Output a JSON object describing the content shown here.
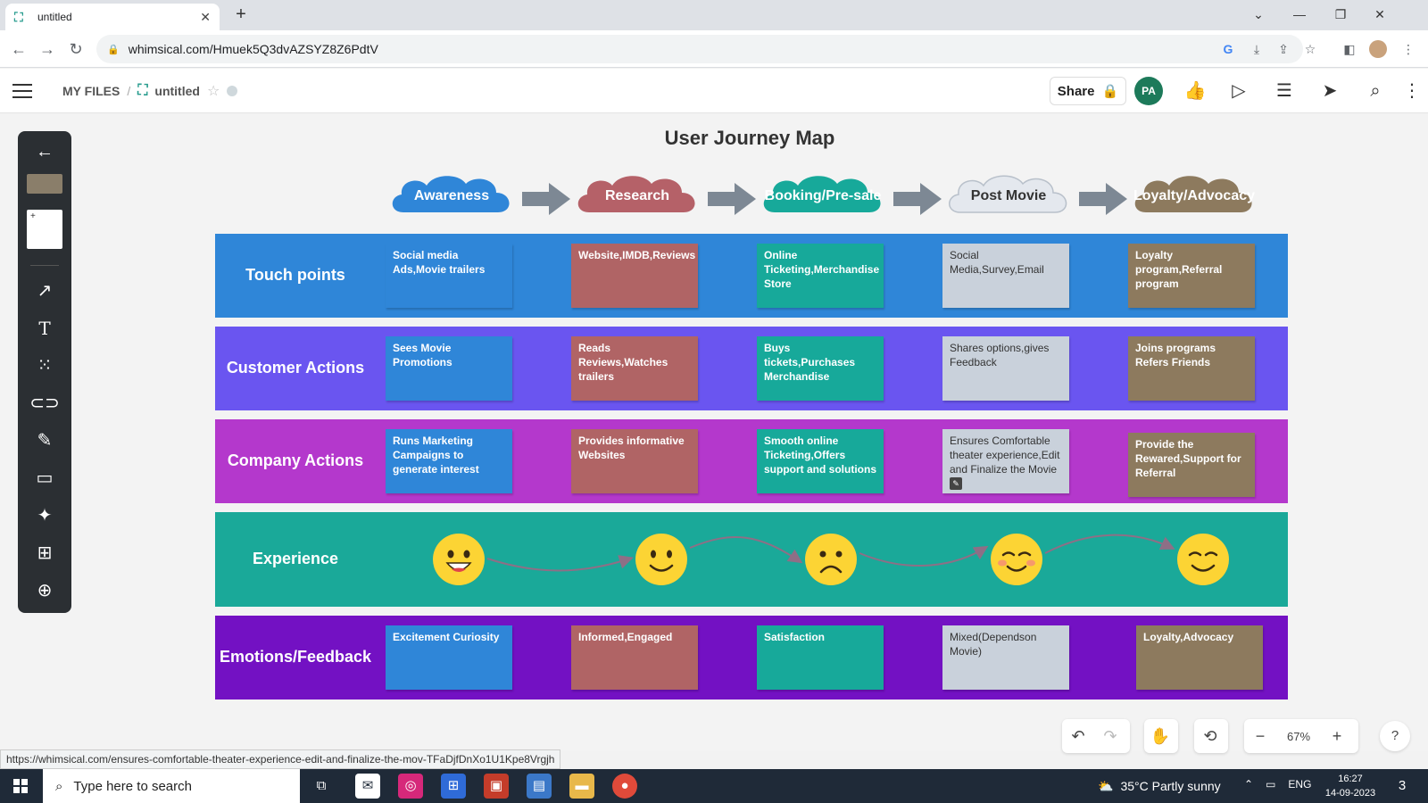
{
  "browser": {
    "tab_title": "untitled",
    "url": "whimsical.com/Hmuek5Q3dvAZSYZ8Z6PdtV",
    "status_url": "https://whimsical.com/ensures-comfortable-theater-experience-edit-and-finalize-the-mov-TFaDjfDnXo1U1Kpe8Vrgjh"
  },
  "header": {
    "my_files": "MY FILES",
    "separator": "/",
    "doc_title": "untitled",
    "share_label": "Share",
    "avatar_initials": "PA"
  },
  "board": {
    "title": "User Journey Map",
    "stages": [
      {
        "label": "Awareness",
        "color": "#2f86d8"
      },
      {
        "label": "Research",
        "color": "#b56168"
      },
      {
        "label": "Booking/Pre-sale",
        "color": "#17a99a"
      },
      {
        "label": "Post Movie",
        "color": "#e4e8ee"
      },
      {
        "label": "Loyalty/Advocacy",
        "color": "#8d7a5e"
      }
    ],
    "rows": [
      {
        "label": "Touch points",
        "color": "#2f86d8",
        "notes": [
          "Social media Ads,Movie trailers",
          "Website,IMDB,Reviews",
          "Online Ticketing,Merchandise Store",
          "Social Media,Survey,Email",
          "Loyalty program,Referral program"
        ]
      },
      {
        "label": "Customer Actions",
        "color": "#6a55f0",
        "notes": [
          "Sees Movie Promotions",
          "Reads Reviews,Watches trailers",
          "Buys tickets,Purchases Merchandise",
          "Shares options,gives Feedback",
          "Joins programs Refers Friends"
        ]
      },
      {
        "label": "Company Actions",
        "color": "#b438cc",
        "notes": [
          "Runs Marketing Campaigns to generate interest",
          "Provides informative Websites",
          "Smooth online Ticketing,Offers support and solutions",
          "Ensures Comfortable theater experience,Edit and Finalize the Movie",
          "Provide the Rewared,Support for Referral"
        ]
      },
      {
        "label": "Experience",
        "color": "#1aa999"
      },
      {
        "label": "Emotions/Feedback",
        "color": "#7311c3",
        "notes": [
          "Excitement Curiosity",
          "Informed,Engaged",
          "Satisfaction",
          "Mixed(Dependson Movie)",
          "Loyalty,Advocacy"
        ]
      }
    ],
    "note_colors": [
      "#2f86d8",
      "#b06465",
      "#17a99a",
      "#c9d1db",
      "#8d7a5e"
    ],
    "faces": [
      "grinning-face",
      "smiling-face",
      "frowning-face",
      "blushing-face",
      "smiling-face"
    ]
  },
  "controls": {
    "zoom": "67%",
    "help": "?"
  },
  "taskbar": {
    "search_placeholder": "Type here to search",
    "weather": "35°C  Partly sunny",
    "language": "ENG",
    "time": "16:27",
    "date": "14-09-2023",
    "notifications": "3"
  }
}
